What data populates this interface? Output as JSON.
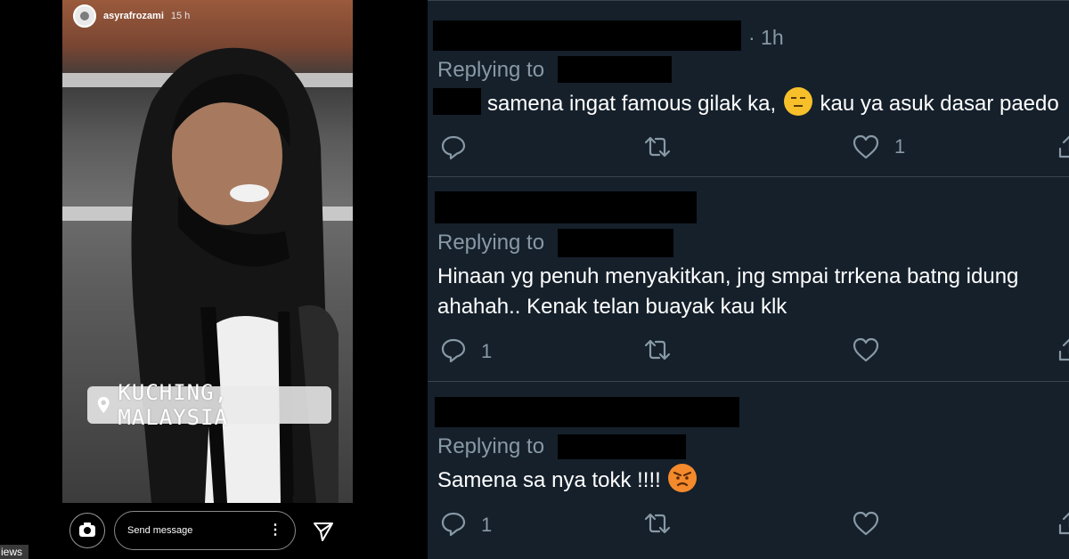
{
  "story": {
    "username": "asyrafrozami",
    "time": "15 h",
    "location": "KUCHING, MALAYSIA",
    "message_placeholder": "Send message",
    "more_glyph": "⋮",
    "views_text": "iews",
    "icons": [
      "avatar",
      "location-pin-icon",
      "camera-icon",
      "more-options-icon",
      "send-icon"
    ]
  },
  "twitter": {
    "colors": {
      "background": "#15202b",
      "muted": "#8899a6",
      "divider": "#38444d",
      "text": "#ffffff"
    },
    "tweets": [
      {
        "time": "· 1h",
        "replying": "Replying to",
        "text_before_emoji": "samena ingat famous gilak ka,",
        "emoji": "expressionless-face",
        "text_after_emoji": "kau ya asuk dasar paedo",
        "reply_count": "",
        "like_count": "1"
      },
      {
        "replying": "Replying to",
        "lines": [
          "Hinaan yg penuh menyakitkan, jng smpai trrkena batng idung",
          "ahahah.. Kenak telan buayak kau klk"
        ],
        "reply_count": "1",
        "like_count": ""
      },
      {
        "replying": "Replying to",
        "text": "Samena sa nya tokk !!!!",
        "emoji": "angry-face",
        "reply_count": "1",
        "like_count": ""
      }
    ]
  }
}
